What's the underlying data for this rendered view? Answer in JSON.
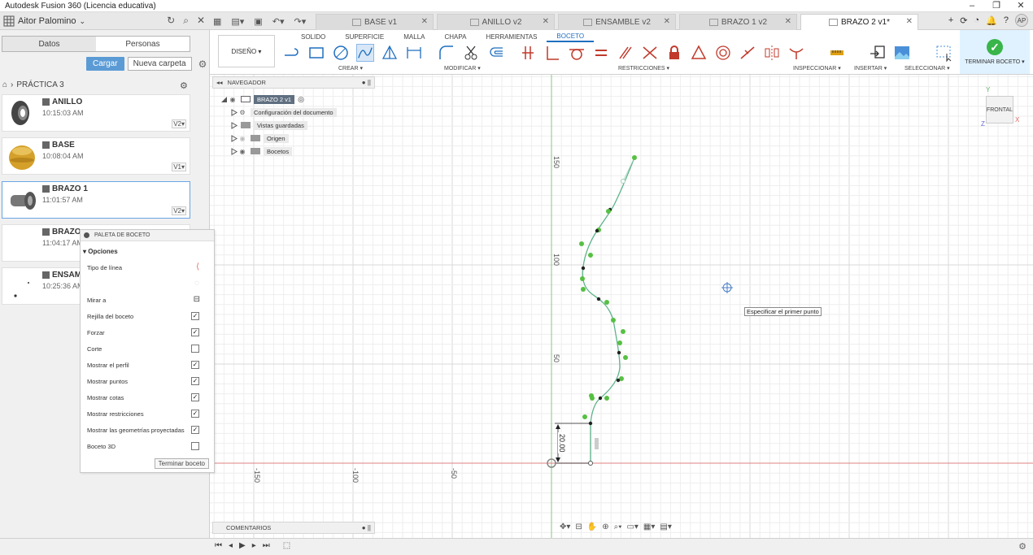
{
  "window": {
    "title": "Autodesk Fusion 360 (Licencia educativa)",
    "controls": [
      "–",
      "❐",
      "✕"
    ]
  },
  "appbar": {
    "user": "Aitor Palomino",
    "user_icons": [
      "↻",
      "⌕",
      "✕"
    ],
    "tabs": [
      {
        "label": "BASE v1",
        "active": false
      },
      {
        "label": "ANILLO v2",
        "active": false
      },
      {
        "label": "ENSAMBLE v2",
        "active": false
      },
      {
        "label": "BRAZO 1 v2",
        "active": false
      },
      {
        "label": "BRAZO 2 v1*",
        "active": true
      }
    ],
    "avatar": "AP",
    "tool_glyphs": [
      "+",
      "⟳",
      "◔",
      "🔔",
      "?"
    ]
  },
  "data_panel": {
    "segments": [
      "Datos",
      "Personas"
    ],
    "upload": "Cargar",
    "new_folder": "Nueva carpeta",
    "project": "PRÁCTICA 3",
    "files": [
      {
        "name": "ANILLO",
        "time": "10:15:03 AM",
        "version": "V2▾"
      },
      {
        "name": "BASE",
        "time": "10:08:04 AM",
        "version": "V1▾"
      },
      {
        "name": "BRAZO 1",
        "time": "11:01:57 AM",
        "version": "V2▾"
      },
      {
        "name": "BRAZO",
        "time": "11:04:17 AM",
        "version": ""
      },
      {
        "name": "ENSAMI",
        "time": "10:25:36 AM",
        "version": ""
      }
    ]
  },
  "ribbon": {
    "workspace": "DISEÑO ▾",
    "tabs": [
      {
        "label": "SOLIDO",
        "active": false
      },
      {
        "label": "SUPERFICIE",
        "active": false
      },
      {
        "label": "MALLA",
        "active": false
      },
      {
        "label": "CHAPA",
        "active": false
      },
      {
        "label": "HERRAMIENTAS",
        "active": false
      },
      {
        "label": "BOCETO",
        "active": true
      }
    ],
    "groups": {
      "crear": "CREAR ▾",
      "modificar": "MODIFICAR ▾",
      "restricciones": "RESTRICCIONES ▾",
      "inspeccionar": "INSPECCIONAR ▾",
      "insertar": "INSERTAR ▾",
      "seleccionar": "SELECCIONAR ▾",
      "terminar": "TERMINAR BOCETO ▾"
    },
    "check_glyph": "✓"
  },
  "navigator": {
    "title": "NAVEGADOR",
    "items": [
      {
        "label": "BRAZO 2 v1",
        "root": true
      },
      {
        "label": "Configuración del documento"
      },
      {
        "label": "Vistas guardadas"
      },
      {
        "label": "Origen"
      },
      {
        "label": "Bocetos"
      }
    ]
  },
  "sketch_palette": {
    "title": "PALETA DE BOCETO",
    "section": "Opciones",
    "rows": [
      {
        "label": "Tipo de línea",
        "checked": null
      },
      {
        "label": "",
        "checked": null
      },
      {
        "label": "Mirar a",
        "checked": null
      },
      {
        "label": "Rejilla del boceto",
        "checked": true
      },
      {
        "label": "Forzar",
        "checked": true
      },
      {
        "label": "Corte",
        "checked": false
      },
      {
        "label": "Mostrar el perfil",
        "checked": true
      },
      {
        "label": "Mostrar puntos",
        "checked": true
      },
      {
        "label": "Mostrar cotas",
        "checked": true
      },
      {
        "label": "Mostrar restricciones",
        "checked": true
      },
      {
        "label": "Mostrar las geometrías proyectadas",
        "checked": true
      },
      {
        "label": "Boceto 3D",
        "checked": false
      }
    ],
    "finish": "Terminar boceto"
  },
  "canvas": {
    "x_ticks": [
      "-150",
      "-100",
      "-50"
    ],
    "y_ticks": [
      "150",
      "100",
      "50"
    ],
    "dimension": "20.00",
    "tooltip": "Especificar el primer punto",
    "viewcube": "FRONTAL",
    "axis_labels": {
      "x": "X",
      "y": "Y",
      "z": "Z"
    }
  },
  "comments": {
    "title": "COMENTARIOS"
  },
  "colors": {
    "accent": "#1f6fbf",
    "spline": "#5fb38b",
    "points": "#56c043",
    "grid": "#eeeeee",
    "axis_x": "#e06666",
    "axis_y": "#7fc47f"
  }
}
